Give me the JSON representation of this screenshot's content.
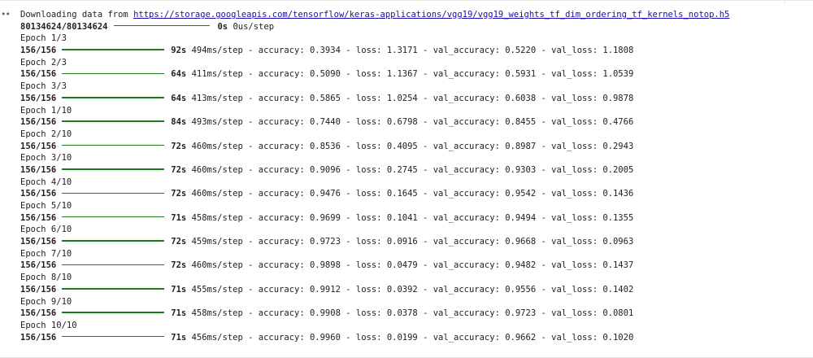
{
  "output_marker": "••",
  "download": {
    "prefix": "Downloading data from ",
    "url": "https://storage.googleapis.com/tensorflow/keras-applications/vgg19/vgg19_weights_tf_dim_ordering_tf_kernels_notop.h5",
    "progress": "80134624/80134624",
    "time": "0s",
    "rate": "0us/step"
  },
  "progress_color": "#1e7b1e",
  "link_color": "#1a0dab",
  "epochs": [
    {
      "label": "Epoch 1/3",
      "steps": "156/156",
      "time": "92s",
      "per_step": "494ms/step",
      "accuracy": "0.3934",
      "loss": "1.3171",
      "val_accuracy": "0.5220",
      "val_loss": "1.1808"
    },
    {
      "label": "Epoch 2/3",
      "steps": "156/156",
      "time": "64s",
      "per_step": "411ms/step",
      "accuracy": "0.5090",
      "loss": "1.1367",
      "val_accuracy": "0.5931",
      "val_loss": "1.0539"
    },
    {
      "label": "Epoch 3/3",
      "steps": "156/156",
      "time": "64s",
      "per_step": "413ms/step",
      "accuracy": "0.5865",
      "loss": "1.0254",
      "val_accuracy": "0.6038",
      "val_loss": "0.9878"
    },
    {
      "label": "Epoch 1/10",
      "steps": "156/156",
      "time": "84s",
      "per_step": "493ms/step",
      "accuracy": "0.7440",
      "loss": "0.6798",
      "val_accuracy": "0.8455",
      "val_loss": "0.4766"
    },
    {
      "label": "Epoch 2/10",
      "steps": "156/156",
      "time": "72s",
      "per_step": "460ms/step",
      "accuracy": "0.8536",
      "loss": "0.4095",
      "val_accuracy": "0.8987",
      "val_loss": "0.2943"
    },
    {
      "label": "Epoch 3/10",
      "steps": "156/156",
      "time": "72s",
      "per_step": "460ms/step",
      "accuracy": "0.9096",
      "loss": "0.2745",
      "val_accuracy": "0.9303",
      "val_loss": "0.2005"
    },
    {
      "label": "Epoch 4/10",
      "steps": "156/156",
      "time": "72s",
      "per_step": "460ms/step",
      "accuracy": "0.9476",
      "loss": "0.1645",
      "val_accuracy": "0.9542",
      "val_loss": "0.1436"
    },
    {
      "label": "Epoch 5/10",
      "steps": "156/156",
      "time": "71s",
      "per_step": "458ms/step",
      "accuracy": "0.9699",
      "loss": "0.1041",
      "val_accuracy": "0.9494",
      "val_loss": "0.1355"
    },
    {
      "label": "Epoch 6/10",
      "steps": "156/156",
      "time": "72s",
      "per_step": "459ms/step",
      "accuracy": "0.9723",
      "loss": "0.0916",
      "val_accuracy": "0.9668",
      "val_loss": "0.0963"
    },
    {
      "label": "Epoch 7/10",
      "steps": "156/156",
      "time": "72s",
      "per_step": "460ms/step",
      "accuracy": "0.9898",
      "loss": "0.0479",
      "val_accuracy": "0.9482",
      "val_loss": "0.1437"
    },
    {
      "label": "Epoch 8/10",
      "steps": "156/156",
      "time": "71s",
      "per_step": "455ms/step",
      "accuracy": "0.9912",
      "loss": "0.0392",
      "val_accuracy": "0.9556",
      "val_loss": "0.1402"
    },
    {
      "label": "Epoch 9/10",
      "steps": "156/156",
      "time": "71s",
      "per_step": "458ms/step",
      "accuracy": "0.9908",
      "loss": "0.0378",
      "val_accuracy": "0.9723",
      "val_loss": "0.0801"
    },
    {
      "label": "Epoch 10/10",
      "steps": "156/156",
      "time": "71s",
      "per_step": "456ms/step",
      "accuracy": "0.9960",
      "loss": "0.0199",
      "val_accuracy": "0.9662",
      "val_loss": "0.1020"
    }
  ]
}
